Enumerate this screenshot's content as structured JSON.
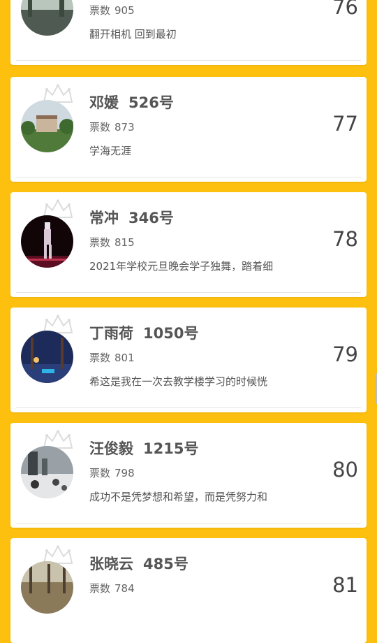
{
  "vote_label": "票数",
  "entries": [
    {
      "name": "",
      "number": "",
      "votes": "905",
      "desc": "翻开相机 回到最初",
      "rank": "76"
    },
    {
      "name": "邓媛",
      "number": "526号",
      "votes": "873",
      "desc": "学海无涯",
      "rank": "77"
    },
    {
      "name": "常冲",
      "number": "346号",
      "votes": "815",
      "desc": "2021年学校元旦晚会学子独舞，踏着细",
      "rank": "78"
    },
    {
      "name": "丁雨荷",
      "number": "1050号",
      "votes": "801",
      "desc": "希这是我在一次去教学楼学习的时候恍",
      "rank": "79"
    },
    {
      "name": "汪俊毅",
      "number": "1215号",
      "votes": "798",
      "desc": "成功不是凭梦想和希望，而是凭努力和",
      "rank": "80"
    },
    {
      "name": "张晓云",
      "number": "485号",
      "votes": "784",
      "desc": "",
      "rank": "81"
    }
  ],
  "colors": {
    "background": "#FDC00F",
    "card": "#FFFFFF"
  },
  "icons": {
    "crown": "crown-icon"
  }
}
